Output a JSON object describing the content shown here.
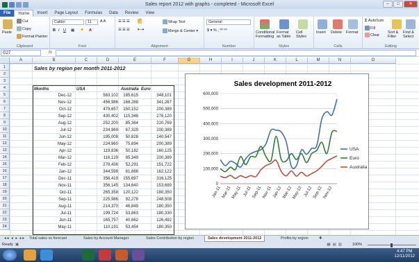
{
  "window": {
    "title": "Sales report 2012 with graphs - completed - Microsoft Excel"
  },
  "tabs": [
    "File",
    "Home",
    "Insert",
    "Page Layout",
    "Formulas",
    "Data",
    "Review",
    "View"
  ],
  "ribbon": {
    "clipboard": {
      "paste": "Paste",
      "cut": "Cut",
      "copy": "Copy",
      "format_painter": "Format Painter",
      "label": "Clipboard"
    },
    "font": {
      "name": "Calibri",
      "size": "11",
      "bold": "B",
      "italic": "I",
      "underline": "U",
      "label": "Font"
    },
    "alignment": {
      "wrap": "Wrap Text",
      "merge": "Merge & Center",
      "label": "Alignment"
    },
    "number": {
      "format": "General",
      "label": "Number"
    },
    "styles": {
      "cond": "Conditional Formatting",
      "format_table": "Format as Table",
      "cell_styles": "Cell Styles",
      "label": "Styles"
    },
    "cells": {
      "insert": "Insert",
      "delete": "Delete",
      "format": "Format",
      "label": "Cells"
    },
    "editing": {
      "autosum": "AutoSum",
      "fill": "Fill",
      "clear": "Clear",
      "sort": "Sort & Filter",
      "find": "Find & Select",
      "label": "Editing"
    }
  },
  "formula_bar": {
    "name_box": "G27",
    "fx": "fx",
    "value": ""
  },
  "columns": [
    "A",
    "B",
    "C",
    "D",
    "E",
    "F",
    "G",
    "H",
    "I",
    "J",
    "K",
    "L",
    "M",
    "N",
    "O"
  ],
  "rows": [
    "1",
    "2",
    "3",
    "4",
    "5",
    "6",
    "7",
    "8",
    "9",
    "10",
    "11",
    "12",
    "13",
    "14",
    "15",
    "16",
    "17",
    "18",
    "19",
    "20",
    "21",
    "22",
    "23",
    "24"
  ],
  "sheet": {
    "title": "Sales by region per month 2011-2012",
    "headers": [
      "Months",
      "USA",
      "Australia",
      "Euro"
    ],
    "data": [
      [
        "Dec-12",
        "563,102",
        "185,615",
        "348,101"
      ],
      [
        "Nov-12",
        "456,986",
        "168,288",
        "341,267"
      ],
      [
        "Oct-12",
        "479,657",
        "150,152",
        "200,389"
      ],
      [
        "Sep-12",
        "430,402",
        "115,348",
        "276,120"
      ],
      [
        "Aug-12",
        "252,200",
        "85,364",
        "220,769"
      ],
      [
        "Jul-12",
        "234,969",
        "67,329",
        "200,389"
      ],
      [
        "Jun-12",
        "195,008",
        "50,828",
        "140,547"
      ],
      [
        "May-12",
        "224,960",
        "75,694",
        "200,389"
      ],
      [
        "Apr-12",
        "119,836",
        "50,182",
        "160,125"
      ],
      [
        "Mar-12",
        "116,129",
        "85,349",
        "200,389"
      ],
      [
        "Feb-12",
        "278,436",
        "52,291",
        "151,722"
      ],
      [
        "Jan-12",
        "344,598",
        "81,868",
        "162,122"
      ],
      [
        "Dec-11",
        "356,419",
        "155,697",
        "316,125"
      ],
      [
        "Nov-11",
        "356,145",
        "134,640",
        "153,689"
      ],
      [
        "Oct-11",
        "265,358",
        "120,122",
        "180,350"
      ],
      [
        "Sep-11",
        "225,986",
        "92,278",
        "248,508"
      ],
      [
        "Aug-11",
        "214,370",
        "46,849",
        "180,350"
      ],
      [
        "Jul-11",
        "199,724",
        "53,863",
        "180,330"
      ],
      [
        "Jun-11",
        "165,757",
        "40,662",
        "126,492"
      ],
      [
        "May-11",
        "110,191",
        "53,454",
        "180,350"
      ]
    ]
  },
  "chart_data": {
    "type": "line",
    "title": "Sales development 2011-2012",
    "x": [
      "Jan-11",
      "Feb-11",
      "Mar-11",
      "Apr-11",
      "May-11",
      "Jun-11",
      "Jul-11",
      "Aug-11",
      "Sep-11",
      "Oct-11",
      "Nov-11",
      "Dec-11",
      "Jan-12",
      "Feb-12",
      "Mar-12",
      "Apr-12",
      "May-12",
      "Jun-12",
      "Jul-12",
      "Aug-12",
      "Sep-12",
      "Oct-12",
      "Nov-12",
      "Dec-12"
    ],
    "x_ticks": [
      "Jan-11",
      "Mar-11",
      "May-11",
      "Jul-11",
      "Sep-11",
      "Nov-11",
      "Jan-12",
      "Mar-12",
      "May-12",
      "Jul-12",
      "Sep-12",
      "Nov-12"
    ],
    "ylim": [
      0,
      600000
    ],
    "y_ticks": [
      "0",
      "100,000",
      "200,000",
      "300,000",
      "400,000",
      "500,000",
      "600,000"
    ],
    "legend": "right",
    "series": [
      {
        "name": "USA",
        "color": "#3f6fb2",
        "values": [
          160000,
          120000,
          150000,
          135000,
          110191,
          165757,
          199724,
          214370,
          225986,
          265358,
          356145,
          356419,
          344598,
          278436,
          116129,
          119836,
          224960,
          195008,
          234969,
          252200,
          430402,
          479657,
          456986,
          563102
        ]
      },
      {
        "name": "Euro",
        "color": "#2e7d32",
        "values": [
          100000,
          80000,
          110000,
          95000,
          180350,
          126492,
          180330,
          180350,
          248508,
          180350,
          153689,
          316125,
          162122,
          151722,
          200389,
          160125,
          200389,
          140547,
          200389,
          220769,
          276120,
          200389,
          341267,
          348101
        ]
      },
      {
        "name": "Australia",
        "color": "#b3523f",
        "values": [
          50000,
          40000,
          55000,
          35000,
          53454,
          40662,
          53863,
          46849,
          92278,
          120122,
          134640,
          155697,
          81868,
          52291,
          85349,
          50182,
          75694,
          50828,
          67329,
          85364,
          115348,
          150152,
          168288,
          185615
        ]
      }
    ]
  },
  "sheet_tabs": [
    "Total sales vs forecast",
    "Sales by Account Manager",
    "Sales Contribution by region",
    "Sales development 2011-2012",
    "Profits by region"
  ],
  "status": {
    "ready": "Ready",
    "zoom": "100%"
  },
  "clock": {
    "time": "4:47 PM",
    "date": "12/11/2012"
  }
}
